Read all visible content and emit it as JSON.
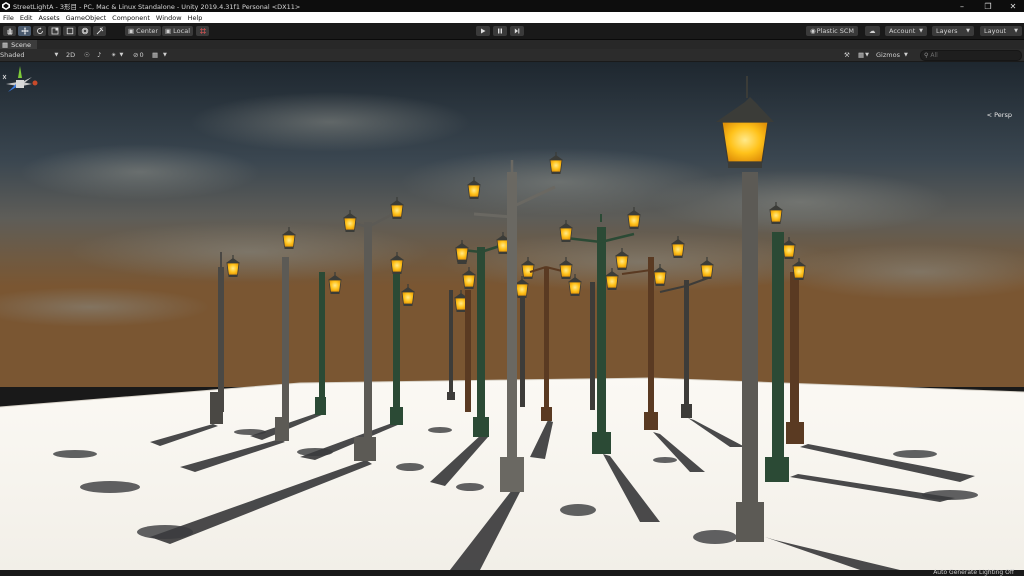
{
  "window": {
    "title": "StreetLightA - 3形目 - PC, Mac & Linux Standalone - Unity 2019.4.31f1 Personal <DX11>"
  },
  "menu": [
    "File",
    "Edit",
    "Assets",
    "GameObject",
    "Component",
    "Window",
    "Help"
  ],
  "toolbar": {
    "pivot_label": "Center",
    "space_label": "Local",
    "plastic_label": "Plastic SCM",
    "account_label": "Account",
    "layers_label": "Layers",
    "layout_label": "Layout"
  },
  "scene_tab": {
    "label": "Scene"
  },
  "scene_toolbar": {
    "draw_mode": "Shaded",
    "mode_2d": "2D",
    "fx_count": "0",
    "gizmos_label": "Gizmos",
    "search_placeholder": "All"
  },
  "viewport": {
    "projection_label": "< Persp"
  },
  "status": {
    "text": "Auto Generate Lighting Off"
  },
  "colors": {
    "lamp_glow": "#ffc21a",
    "floor": "#f7f5f0",
    "sky_top": "#1d262e",
    "horizon": "#7a5632"
  }
}
